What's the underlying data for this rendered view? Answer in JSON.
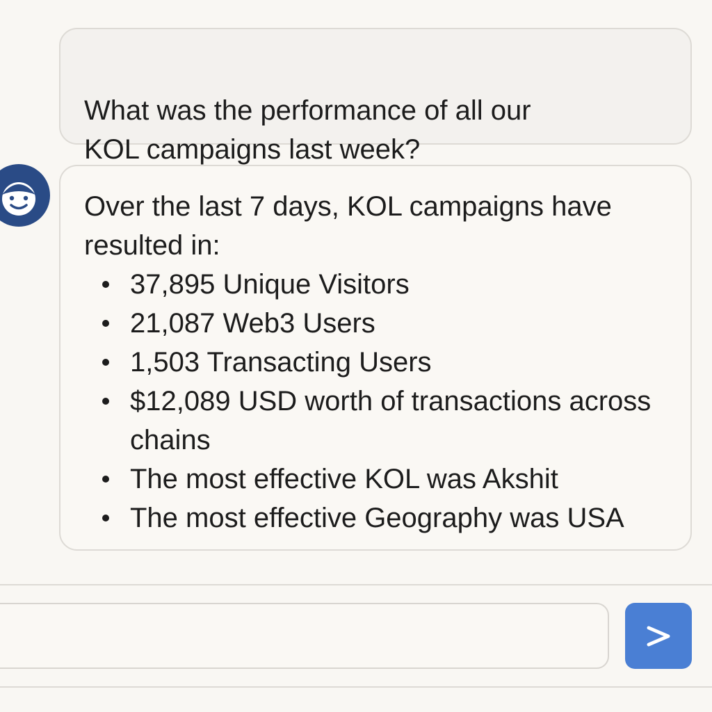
{
  "chat": {
    "user_message": "What was the performance of all our\nKOL campaigns last week?",
    "assistant": {
      "intro": "Over the last 7 days, KOL campaigns have resulted in:",
      "items": [
        "37,895 Unique Visitors",
        "21,087 Web3 Users",
        "1,503 Transacting Users",
        "$12,089 USD worth of transactions across chains",
        "The most effective KOL was Akshit",
        "The most effective Geography was USA"
      ]
    }
  },
  "composer": {
    "placeholder": "",
    "value": ""
  },
  "icons": {
    "avatar": "smiley-face-icon",
    "send": "chevron-right-icon"
  },
  "colors": {
    "background": "#f9f7f3",
    "avatar": "#2a4b86",
    "send_button": "#4a7fd4"
  }
}
